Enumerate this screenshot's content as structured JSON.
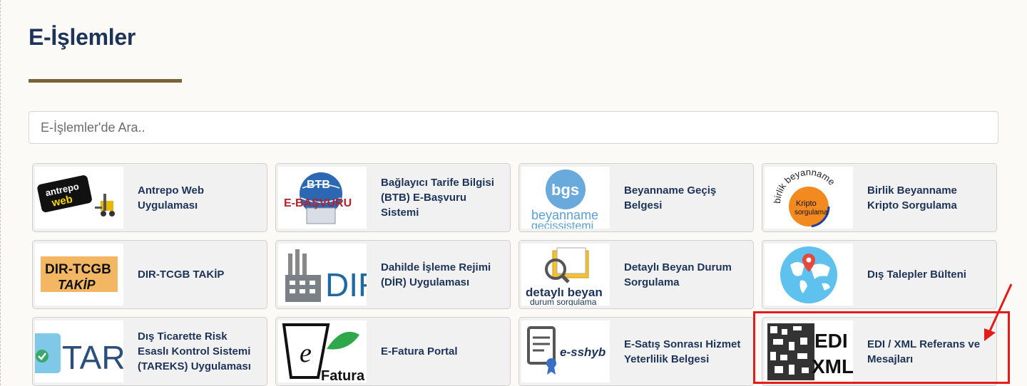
{
  "page": {
    "title": "E-İşlemler"
  },
  "search": {
    "placeholder": "E-İşlemler'de Ara.."
  },
  "cards": [
    {
      "label": "Antrepo Web Uygulaması",
      "icon": "antrepo-web-logo",
      "logo_text": [
        "antrepo",
        "web"
      ]
    },
    {
      "label": "Bağlayıcı Tarife Bilgisi (BTB) E-Başvuru Sistemi",
      "icon": "btb-ebasvuru-logo",
      "logo_text": [
        "BTB",
        "E-BAŞVURU"
      ]
    },
    {
      "label": "Beyanname Geçiş Belgesi",
      "icon": "bgs-logo",
      "logo_text": [
        "bgs",
        "beyanname",
        "geçişsistemi"
      ]
    },
    {
      "label": "Birlik Beyanname Kripto Sorgulama",
      "icon": "birlik-beyanname-logo",
      "logo_text": [
        "birlik beyanname",
        "Kripto",
        "sorgulama"
      ]
    },
    {
      "label": "DIR-TCGB TAKİP",
      "icon": "dir-tcgb-logo",
      "logo_text": [
        "DIR-TCGB",
        "TAKİP"
      ]
    },
    {
      "label": "Dahilde İşleme Rejimi (DİR) Uygulaması",
      "icon": "dir-factory-logo",
      "logo_text": [
        "DIR"
      ]
    },
    {
      "label": "Detaylı Beyan Durum Sorgulama",
      "icon": "detayli-beyan-logo",
      "logo_text": [
        "detaylı beyan",
        "durum sorgulama"
      ]
    },
    {
      "label": "Dış Talepler Bülteni",
      "icon": "world-map-pin-icon",
      "logo_text": []
    },
    {
      "label": "Dış Ticarette Risk Esaslı Kontrol Sistemi (TAREKS) Uygulaması",
      "icon": "tareks-logo",
      "logo_text": [
        "TARE"
      ]
    },
    {
      "label": "E-Fatura Portal",
      "icon": "efatura-logo",
      "logo_text": [
        "e",
        "Fatura"
      ]
    },
    {
      "label": "E-Satış Sonrası Hizmet Yeterlilik Belgesi",
      "icon": "esshyb-logo",
      "logo_text": [
        "e-sshyb"
      ]
    },
    {
      "label": "EDI / XML Referans ve Mesajları",
      "icon": "edi-xml-logo",
      "logo_text": [
        "EDI",
        "XML"
      ]
    }
  ],
  "colors": {
    "title": "#1d3358",
    "underline": "#7a6334",
    "highlight": "#e31b1b",
    "card_bg": "#f1f1f1"
  }
}
